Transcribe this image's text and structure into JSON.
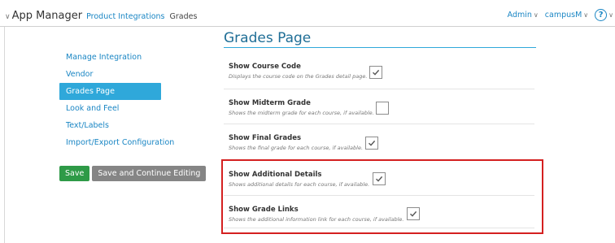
{
  "topbar": {
    "app_title": "App Manager",
    "breadcrumb_link": "Product Integrations",
    "breadcrumb_current": "Grades",
    "user_menu": "Admin",
    "tenant_menu": "campusM",
    "help_glyph": "?"
  },
  "sidebar": {
    "items": [
      {
        "label": "Manage Integration"
      },
      {
        "label": "Vendor"
      },
      {
        "label": "Grades Page"
      },
      {
        "label": "Look and Feel"
      },
      {
        "label": "Text/Labels"
      },
      {
        "label": "Import/Export Configuration"
      }
    ],
    "active_index": 2
  },
  "buttons": {
    "save_label": "Save",
    "save_continue_label": "Save and Continue Editing"
  },
  "main": {
    "title": "Grades Page",
    "settings": [
      {
        "label": "Show Course Code",
        "description": "Displays the course code on the Grades detail page.",
        "checked": true
      },
      {
        "label": "Show Midterm Grade",
        "description": "Shows the midterm grade for each course, if available.",
        "checked": false
      },
      {
        "label": "Show Final Grades",
        "description": "Shows the final grade for each course, if available.",
        "checked": true
      },
      {
        "label": "Show Additional Details",
        "description": "Shows additional details for each course, if available.",
        "checked": true
      },
      {
        "label": "Show Grade Links",
        "description": "Shows the additional information link for each course, if available.",
        "checked": true
      }
    ]
  },
  "colors": {
    "accent": "#2fa8da",
    "link": "#1a86c4",
    "save_button": "#2e9a47",
    "secondary_button": "#858585",
    "highlight_border": "#d42020"
  },
  "icons": {
    "nav_chevron": "chevron-down-icon",
    "checkbox": "checkmark-icon",
    "help": "help-circle-icon"
  }
}
